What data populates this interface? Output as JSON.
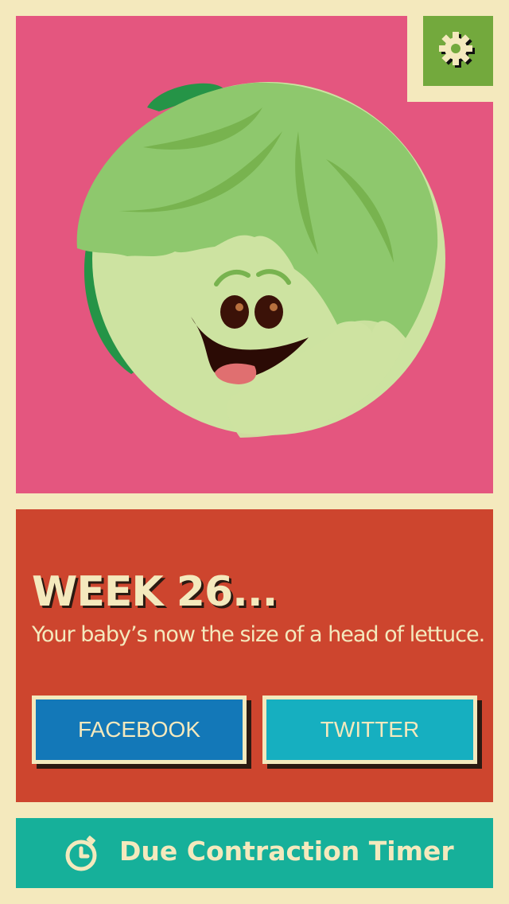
{
  "hero": {
    "character": "lettuce-illustration"
  },
  "settings": {
    "icon": "gear-icon"
  },
  "week": {
    "title": "WEEK 26...",
    "description": "Your baby’s now the size of a head of lettuce."
  },
  "share": {
    "facebook_label": "FACEBOOK",
    "twitter_label": "TWITTER"
  },
  "timer": {
    "icon": "stopwatch-icon",
    "label": "Due Contraction Timer"
  },
  "colors": {
    "background": "#f4e9bd",
    "hero": "#e4567f",
    "card": "#cd452e",
    "facebook": "#1378b8",
    "twitter": "#16afc0",
    "timer_bar": "#16b09a",
    "settings": "#73a93d"
  }
}
